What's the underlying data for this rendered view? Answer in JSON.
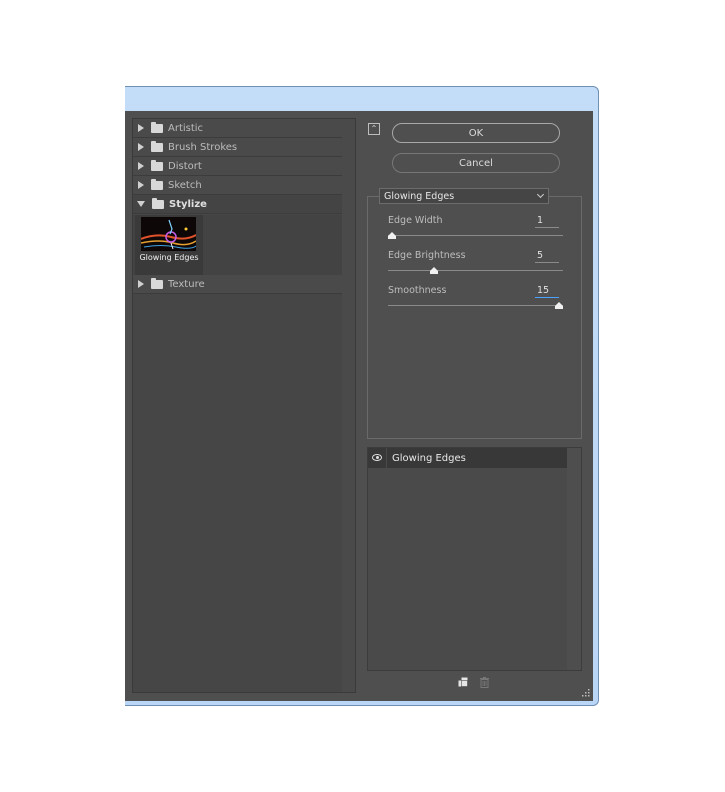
{
  "filter_tree": {
    "folders": [
      {
        "label": "Artistic",
        "expanded": false
      },
      {
        "label": "Brush Strokes",
        "expanded": false
      },
      {
        "label": "Distort",
        "expanded": false
      },
      {
        "label": "Sketch",
        "expanded": false
      },
      {
        "label": "Stylize",
        "expanded": true
      },
      {
        "label": "Texture",
        "expanded": false
      }
    ],
    "selected_thumbnail": {
      "label": "Glowing Edges",
      "icon": "glowing-edges-thumbnail"
    }
  },
  "actions": {
    "collapse_icon": "double-chevron-up-icon",
    "ok_label": "OK",
    "cancel_label": "Cancel"
  },
  "settings": {
    "filter_select": {
      "value": "Glowing Edges"
    },
    "params": [
      {
        "label": "Edge Width",
        "value": "1",
        "min": 1,
        "max": 14,
        "level": 1
      },
      {
        "label": "Edge Brightness",
        "value": "5",
        "min": 0,
        "max": 20,
        "level": 5
      },
      {
        "label": "Smoothness",
        "value": "15",
        "min": 1,
        "max": 15,
        "level": 15
      }
    ]
  },
  "layer_stack": {
    "layers": [
      {
        "label": "Glowing Edges",
        "visible": true,
        "icon": "eye-icon"
      }
    ]
  },
  "footer_icons": [
    "new-effect-layer-icon",
    "delete-effect-layer-icon"
  ],
  "colors": {
    "panel_bg": "#4f4f4f",
    "window_frame": "#bad6f6",
    "focus_accent": "#4aa3ff"
  }
}
